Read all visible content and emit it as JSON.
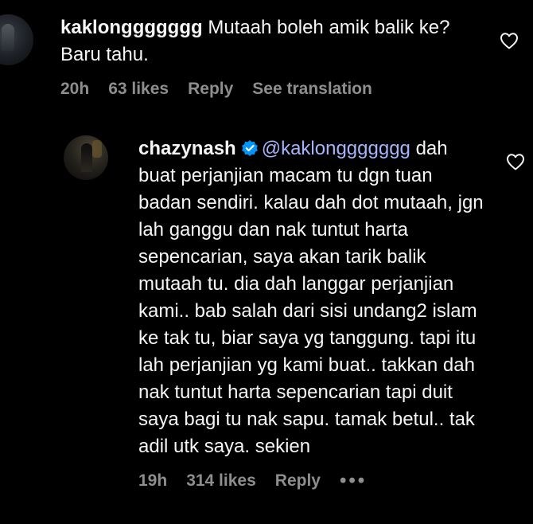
{
  "comments": [
    {
      "username": "kaklonggggggg",
      "text": "Mutaah boleh amik balik ke? Baru tahu.",
      "time": "20h",
      "likes": "63 likes",
      "reply_label": "Reply",
      "translation_label": "See translation",
      "like_icon": "heart-outline-icon"
    },
    {
      "username": "chazynash",
      "verified": true,
      "mention": "@kaklonggggggg",
      "text": "dah buat perjanjian macam tu dgn tuan badan sendiri. kalau dah dot mutaah, jgn lah ganggu dan nak tuntut harta sepencarian, saya akan tarik balik mutaah tu. dia dah langgar perjanjian kami.. bab salah dari sisi undang2 islam ke tak tu, biar saya yg tanggung. tapi itu lah perjanjian yg kami buat.. takkan dah nak tuntut harta sepencarian tapi duit saya bagi tu nak sapu. tamak betul.. tak adil utk saya. sekien",
      "time": "19h",
      "likes": "314 likes",
      "reply_label": "Reply",
      "more_label": "•••",
      "like_icon": "heart-outline-icon"
    }
  ],
  "colors": {
    "background": "#000000",
    "text": "#f5f5f5",
    "secondary": "#8e8e8e",
    "mention": "#a5b4fc",
    "verified": "#0095f6"
  }
}
